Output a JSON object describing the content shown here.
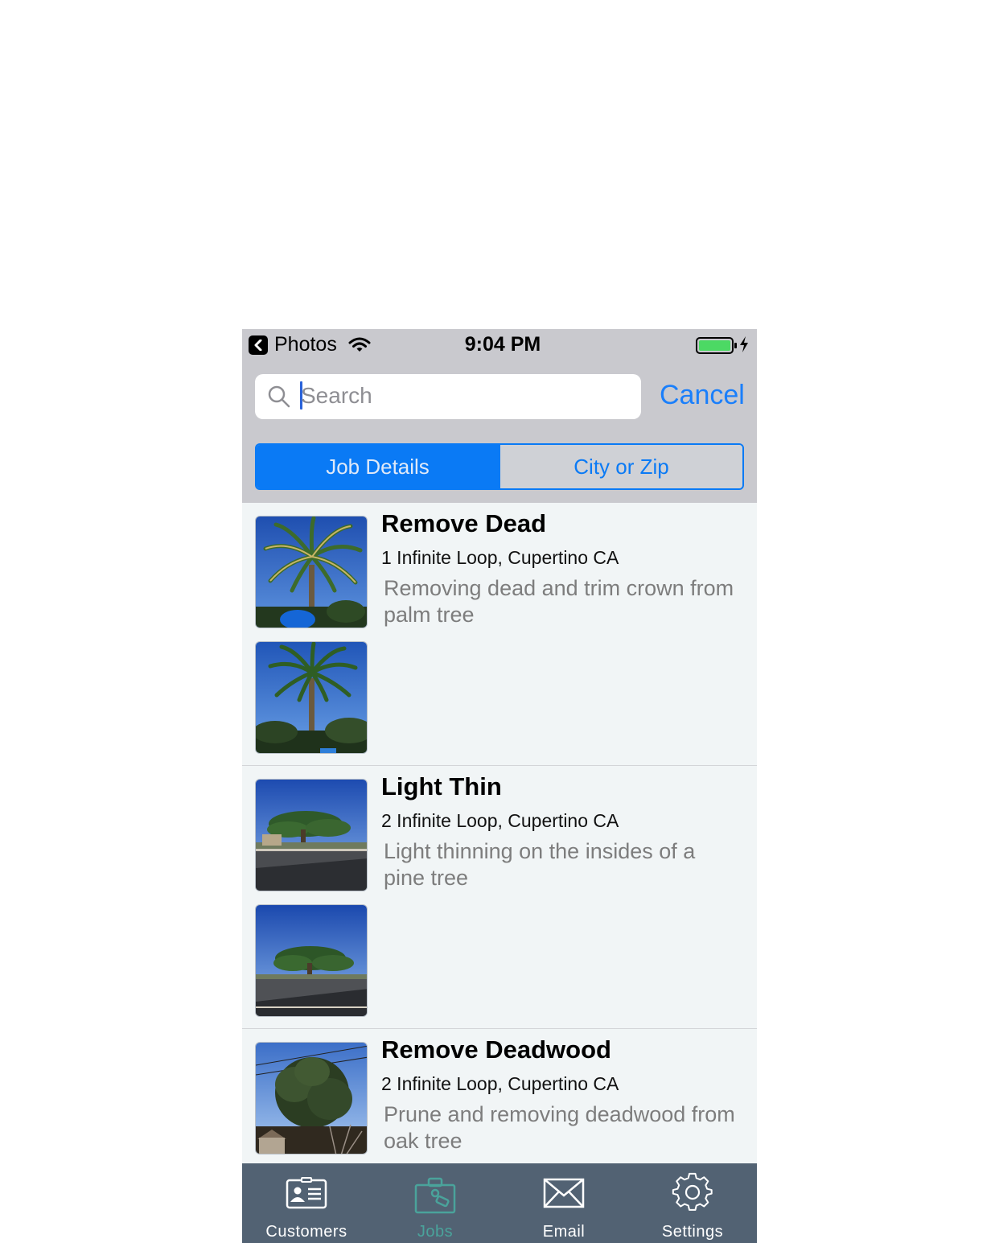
{
  "status_bar": {
    "back_app": "Photos",
    "time": "9:04 PM"
  },
  "search": {
    "placeholder": "Search",
    "value": "",
    "cancel_label": "Cancel"
  },
  "segments": {
    "items": [
      "Job Details",
      "City or Zip"
    ],
    "selected": "Job Details"
  },
  "jobs": [
    {
      "title": "Remove Dead",
      "address": "1 Infinite Loop, Cupertino CA",
      "description": "Removing dead and trim crown from palm tree",
      "photos": [
        "palm-tree-photo",
        "palm-tree-photo"
      ]
    },
    {
      "title": "Light Thin",
      "address": "2 Infinite Loop, Cupertino CA",
      "description": "Light thinning on the insides of a pine tree",
      "photos": [
        "pine-tree-street-photo",
        "pine-tree-street-photo"
      ]
    },
    {
      "title": "Remove Deadwood",
      "address": "2 Infinite Loop, Cupertino CA",
      "description": "Prune and removing deadwood from oak tree",
      "photos": [
        "oak-tree-photo"
      ]
    }
  ],
  "tab_bar": {
    "items": [
      {
        "label": "Customers",
        "icon": "contact-card-icon"
      },
      {
        "label": "Jobs",
        "icon": "briefcase-icon"
      },
      {
        "label": "Email",
        "icon": "envelope-icon"
      },
      {
        "label": "Settings",
        "icon": "gear-icon"
      }
    ],
    "selected": "Jobs"
  },
  "colors": {
    "accent": "#0a7af5",
    "tab_bar_bg": "#526273",
    "tab_selected": "#4aa39b",
    "list_bg": "#f1f5f6",
    "battery": "#4cd964"
  }
}
